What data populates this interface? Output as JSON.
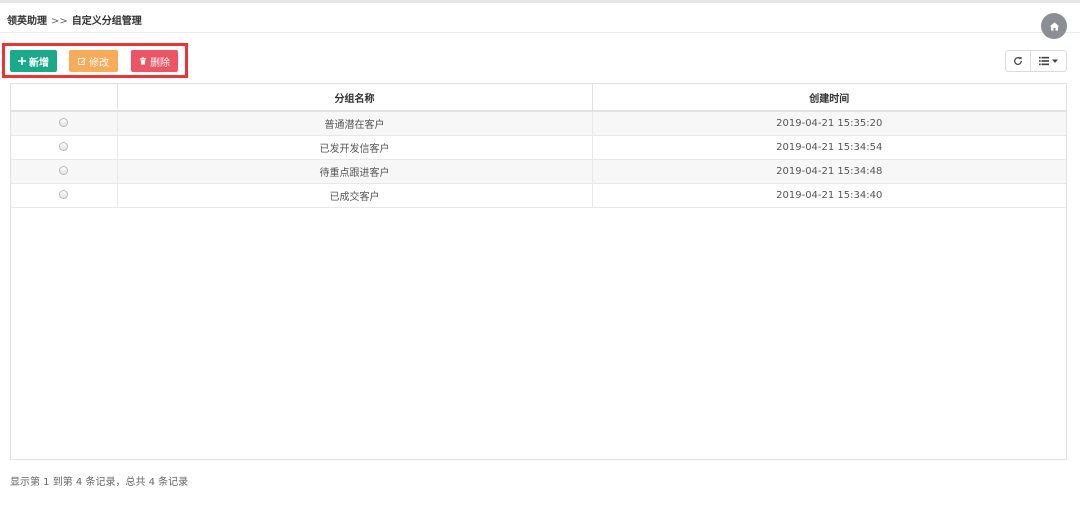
{
  "breadcrumb": {
    "root": "领英助理",
    "separator": ">>",
    "current": "自定义分组管理"
  },
  "header": {
    "home_icon": "home-icon"
  },
  "toolbar": {
    "add_label": "新增",
    "edit_label": "修改",
    "delete_label": "删除",
    "add_color": "#1aaa8a",
    "edit_color": "#f8ac59",
    "delete_color": "#ed5565",
    "highlight_color": "#ee3333"
  },
  "table": {
    "columns": [
      "",
      "分组名称",
      "创建时间"
    ],
    "rows": [
      {
        "name": "普通潜在客户",
        "created": "2019-04-21 15:35:20"
      },
      {
        "name": "已发开发信客户",
        "created": "2019-04-21 15:34:54"
      },
      {
        "name": "待重点跟进客户",
        "created": "2019-04-21 15:34:48"
      },
      {
        "name": "已成交客户",
        "created": "2019-04-21 15:34:40"
      }
    ]
  },
  "pagination": {
    "info": "显示第 1 到第 4 条记录，总共 4 条记录"
  }
}
